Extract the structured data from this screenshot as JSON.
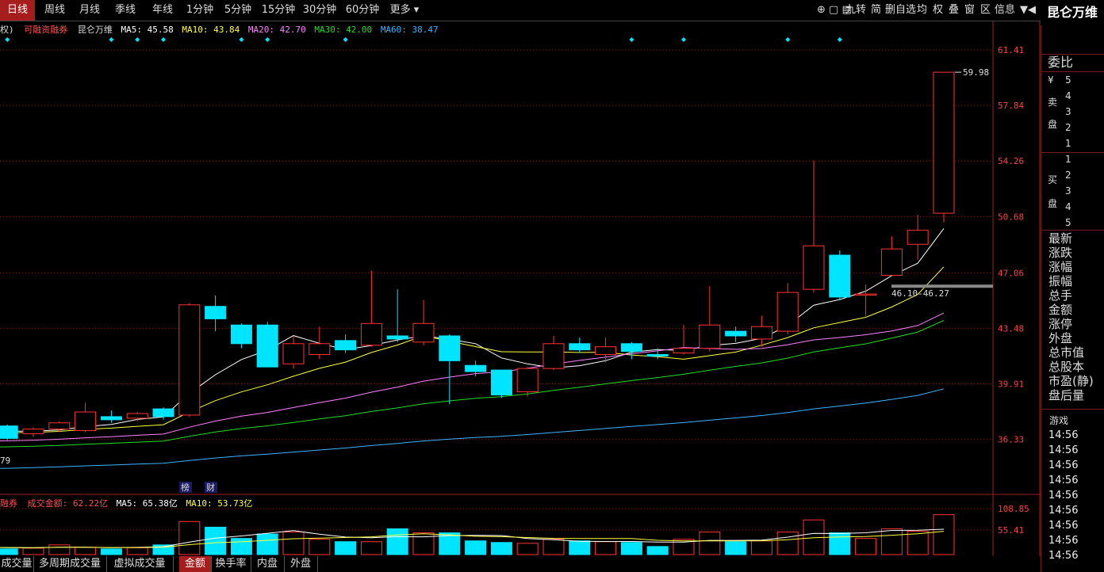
{
  "toolbar": {
    "tabs": [
      "日线",
      "周线",
      "月线",
      "季线",
      "年线",
      "1分钟",
      "5分钟",
      "15分钟",
      "30分钟",
      "60分钟",
      "更多"
    ],
    "active_tab": "日线",
    "icons": [
      "九转",
      "简",
      "删自选",
      "均",
      "权",
      "叠",
      "窗",
      "区",
      "信息"
    ]
  },
  "stock_name": "昆仑万维",
  "main_legend": {
    "prefix": "权)",
    "margin_label": "可融资融券",
    "name": "昆仑万维",
    "ma5": "MA5: 45.58",
    "ma10": "MA10: 43.84",
    "ma20": "MA20: 42.70",
    "ma30": "MA30: 42.00",
    "ma60": "MA60: 38.47"
  },
  "price_axis": [
    "61.41",
    "57.84",
    "54.26",
    "50.68",
    "47.06",
    "43.48",
    "39.91",
    "36.33"
  ],
  "max_price_label": "59.98",
  "range_label": "46.10-46.27",
  "left_min_label": "79",
  "badges": [
    "榜",
    "财"
  ],
  "volume_legend": {
    "prefix": "融券",
    "label": "成交金额: 62.22亿",
    "ma5": "MA5: 65.38亿",
    "ma10": "MA10: 53.73亿"
  },
  "volume_axis": [
    "108.85",
    "55.41"
  ],
  "bottom_tabs": [
    "成交量",
    "多周期成交量",
    "虚拟成交量",
    "金额",
    "换手率",
    "内盘",
    "外盘"
  ],
  "active_bottom_tab": "金额",
  "right_panel": {
    "weibi": "委比",
    "yen": "¥",
    "sell_label": [
      "卖",
      "盘"
    ],
    "buy_label": [
      "买",
      "盘"
    ],
    "sell_levels": [
      "5",
      "4",
      "3",
      "2",
      "1"
    ],
    "buy_levels": [
      "1",
      "2",
      "3",
      "4",
      "5"
    ],
    "fields": [
      "最新",
      "涨跌",
      "涨幅",
      "振幅",
      "总手",
      "金额",
      "涨停",
      "外盘",
      "总市值",
      "总股本",
      "市盈(静)",
      "盘后量"
    ],
    "trade_header": "游戏",
    "trade_times": [
      "14:56",
      "14:56",
      "14:56",
      "14:56",
      "14:56",
      "14:56",
      "14:56",
      "14:56",
      "14:56"
    ]
  },
  "colors": {
    "up": "#ff3232",
    "down": "#00e5ff",
    "ma5": "#ffffff",
    "ma10": "#ffff3c",
    "ma20": "#ff80ff",
    "ma30": "#22dd22",
    "ma60": "#3cb4ff",
    "grid": "#7a1a1a"
  },
  "chart_data": {
    "type": "candlestick",
    "price_range": [
      33.0,
      63.2
    ],
    "candles": [
      {
        "o": 37.2,
        "c": 36.9,
        "h": 37.6,
        "l": 36.6
      },
      {
        "o": 37.2,
        "c": 36.4,
        "h": 37.3,
        "l": 36.3
      },
      {
        "o": 36.7,
        "c": 37.0,
        "h": 37.1,
        "l": 36.5
      },
      {
        "o": 37.0,
        "c": 37.4,
        "h": 37.5,
        "l": 36.8
      },
      {
        "o": 36.9,
        "c": 38.1,
        "h": 38.7,
        "l": 36.8
      },
      {
        "o": 37.8,
        "c": 37.6,
        "h": 38.2,
        "l": 37.4
      },
      {
        "o": 37.7,
        "c": 38.0,
        "h": 38.1,
        "l": 37.5
      },
      {
        "o": 38.3,
        "c": 37.8,
        "h": 38.4,
        "l": 37.6
      },
      {
        "o": 37.9,
        "c": 45.0,
        "h": 45.1,
        "l": 37.8
      },
      {
        "o": 44.9,
        "c": 44.1,
        "h": 45.6,
        "l": 43.3
      },
      {
        "o": 43.7,
        "c": 42.5,
        "h": 43.8,
        "l": 42.2
      },
      {
        "o": 43.7,
        "c": 41.0,
        "h": 43.9,
        "l": 41.0
      },
      {
        "o": 41.2,
        "c": 42.5,
        "h": 43.0,
        "l": 40.9
      },
      {
        "o": 41.8,
        "c": 42.5,
        "h": 43.6,
        "l": 41.5
      },
      {
        "o": 42.7,
        "c": 42.1,
        "h": 43.1,
        "l": 41.9
      },
      {
        "o": 42.4,
        "c": 43.8,
        "h": 47.2,
        "l": 42.3
      },
      {
        "o": 43.0,
        "c": 42.8,
        "h": 46.0,
        "l": 42.6
      },
      {
        "o": 42.6,
        "c": 43.8,
        "h": 45.3,
        "l": 42.4
      },
      {
        "o": 43.0,
        "c": 41.4,
        "h": 43.1,
        "l": 38.6
      },
      {
        "o": 41.1,
        "c": 40.7,
        "h": 41.4,
        "l": 40.4
      },
      {
        "o": 40.8,
        "c": 39.2,
        "h": 40.8,
        "l": 39.0
      },
      {
        "o": 39.4,
        "c": 40.9,
        "h": 41.0,
        "l": 39.1
      },
      {
        "o": 40.9,
        "c": 42.5,
        "h": 43.0,
        "l": 40.8
      },
      {
        "o": 42.5,
        "c": 42.1,
        "h": 42.9,
        "l": 41.9
      },
      {
        "o": 41.8,
        "c": 42.3,
        "h": 42.9,
        "l": 41.3
      },
      {
        "o": 42.5,
        "c": 42.0,
        "h": 42.6,
        "l": 41.5
      },
      {
        "o": 41.8,
        "c": 41.7,
        "h": 42.2,
        "l": 41.5
      },
      {
        "o": 41.9,
        "c": 42.2,
        "h": 43.7,
        "l": 41.8
      },
      {
        "o": 42.2,
        "c": 43.7,
        "h": 46.2,
        "l": 42.0
      },
      {
        "o": 43.3,
        "c": 43.0,
        "h": 43.6,
        "l": 42.6
      },
      {
        "o": 42.8,
        "c": 43.6,
        "h": 44.3,
        "l": 42.3
      },
      {
        "o": 43.3,
        "c": 45.8,
        "h": 46.4,
        "l": 43.1
      },
      {
        "o": 46.0,
        "c": 48.8,
        "h": 54.3,
        "l": 45.8
      },
      {
        "o": 48.2,
        "c": 45.5,
        "h": 48.5,
        "l": 45.3
      },
      {
        "o": 45.7,
        "c": 45.7,
        "h": 46.3,
        "l": 44.3
      },
      {
        "o": 46.9,
        "c": 48.6,
        "h": 49.4,
        "l": 46.9
      },
      {
        "o": 48.9,
        "c": 49.8,
        "h": 50.8,
        "l": 47.9
      },
      {
        "o": 50.9,
        "c": 59.98,
        "h": 59.98,
        "l": 50.3
      }
    ],
    "volume_range": [
      0,
      118
    ],
    "volume": [
      18,
      14,
      16,
      24,
      18,
      14,
      17,
      24,
      82,
      68,
      40,
      51,
      56,
      38,
      32,
      32,
      64,
      54,
      54,
      34,
      30,
      28,
      38,
      34,
      32,
      30,
      20,
      38,
      56,
      32,
      34,
      56,
      86,
      54,
      40,
      64,
      58,
      99
    ]
  }
}
